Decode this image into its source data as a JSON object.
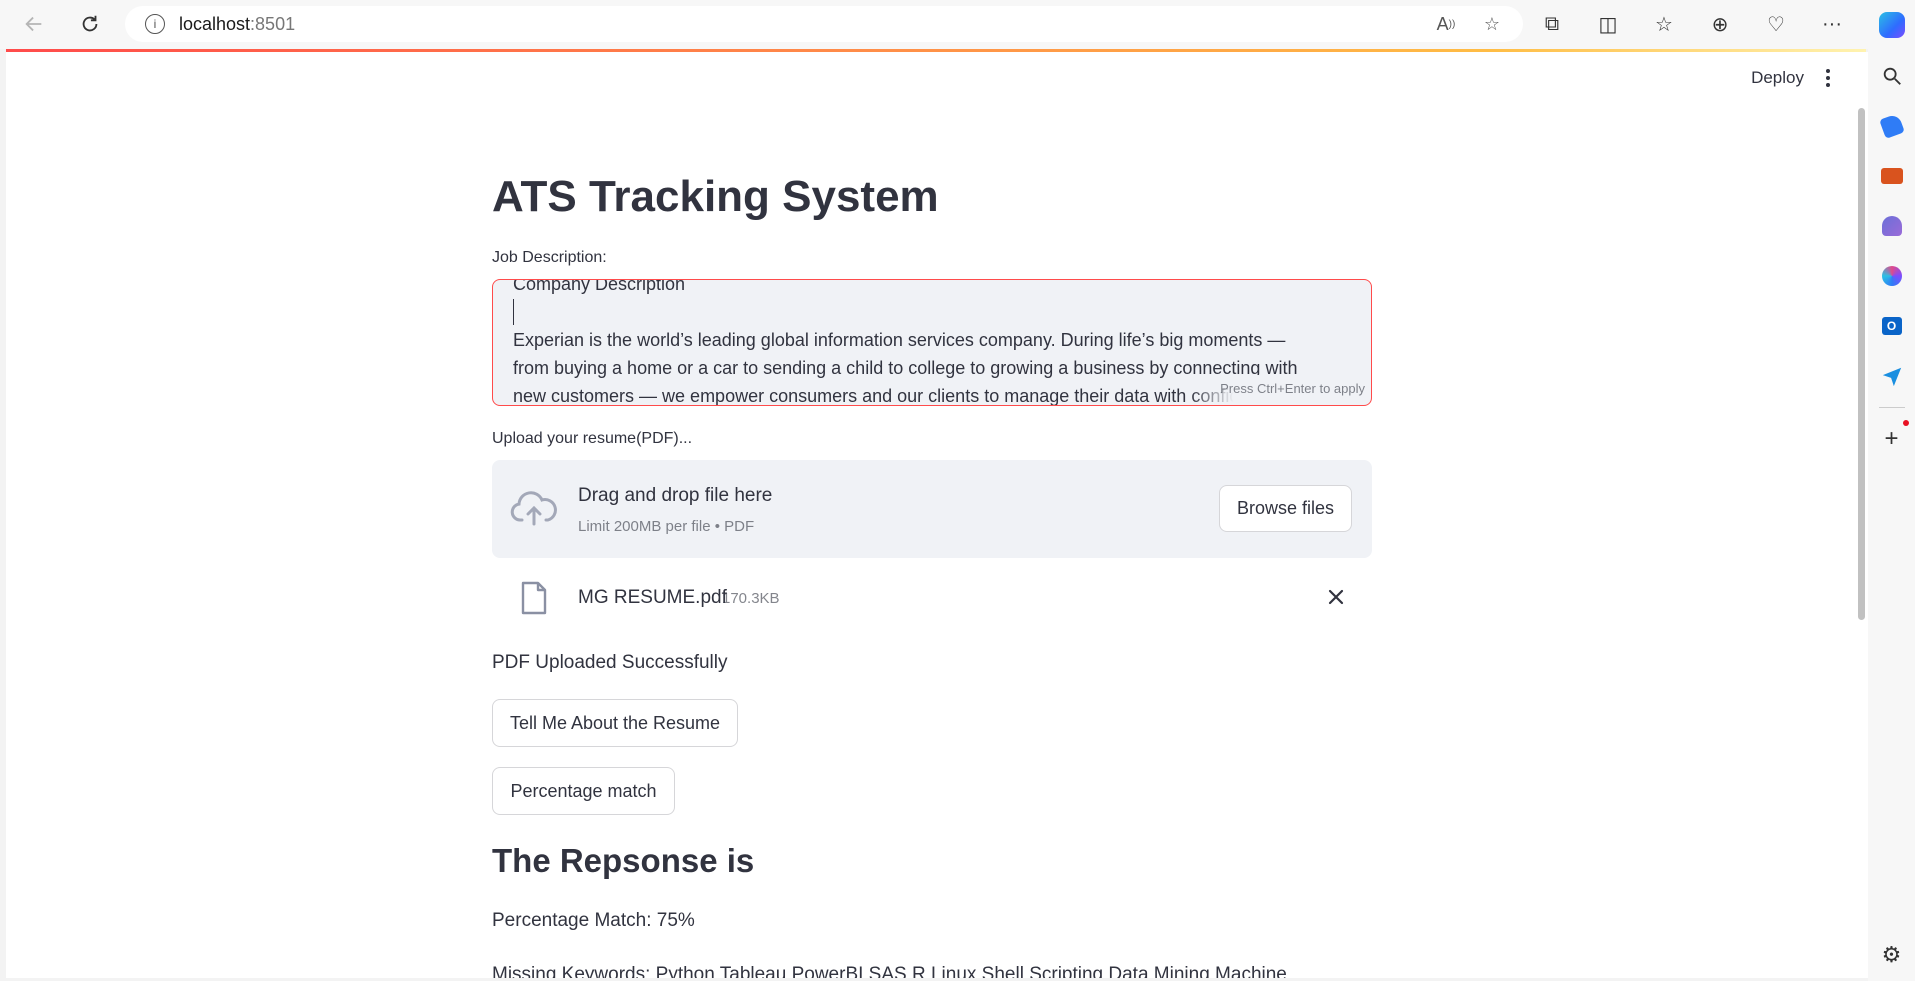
{
  "browser": {
    "address_host": "localhost",
    "address_port": ":8501"
  },
  "header": {
    "deploy_label": "Deploy"
  },
  "main": {
    "title": "ATS Tracking System",
    "jd_label": "Job Description:",
    "jd_lines": [
      "Company Description",
      "Experian is the world’s leading global information services company. During life’s big moments —",
      "from buying a home or a car to sending a child to college to growing a business by connecting with",
      "new customers — we empower consumers and our clients to manage their data with confidence. We"
    ],
    "jd_hint": "Press Ctrl+Enter to apply",
    "upload_label": "Upload your resume(PDF)...",
    "dropzone_title": "Drag and drop file here",
    "dropzone_sub": "Limit 200MB per file • PDF",
    "browse_label": "Browse files",
    "file_name": "MG RESUME.pdf",
    "file_size": "170.3KB",
    "status": "PDF Uploaded Successfully",
    "btn_tell": "Tell Me About the Resume",
    "btn_match": "Percentage match",
    "response_title": "The Repsonse is",
    "response_match": "Percentage Match: 75%",
    "response_missing": "Missing Keywords: Python Tableau PowerBI SAS R Linux Shell Scripting Data Mining Machine"
  },
  "colors": {
    "accent": "#ff4b4b",
    "text": "#31333f",
    "surface": "#f0f2f6"
  }
}
